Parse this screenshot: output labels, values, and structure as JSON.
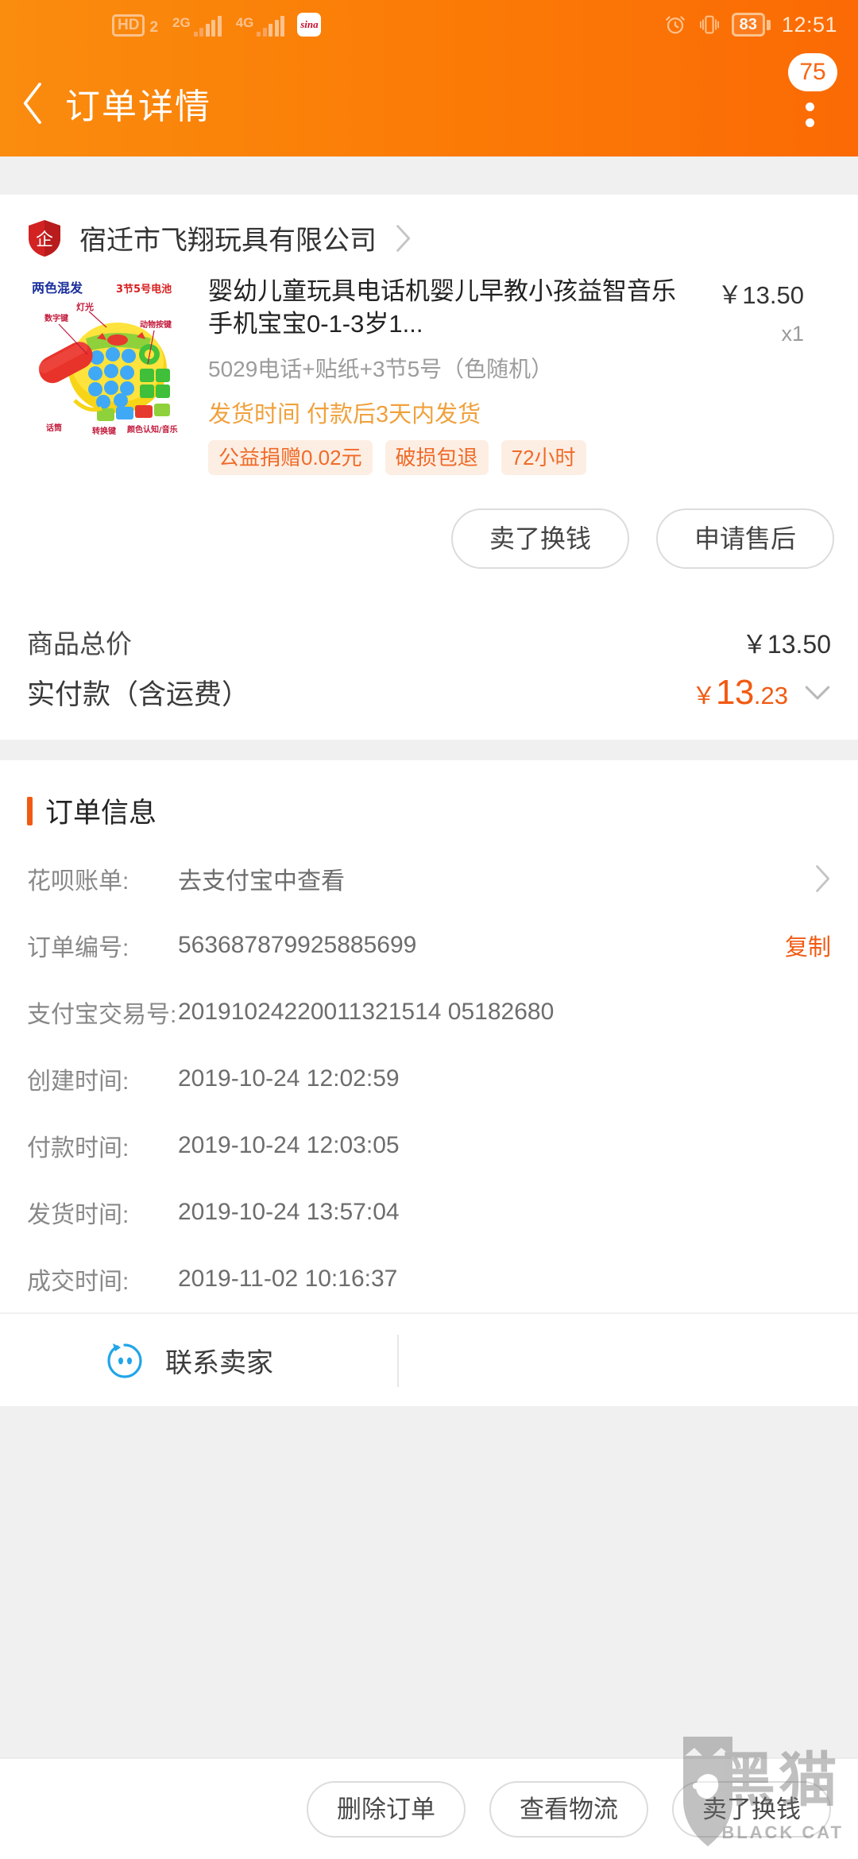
{
  "status_bar": {
    "hd_label": "HD",
    "sim_number": "2",
    "net1_label": "2G",
    "net2_label": "4G",
    "app_icon": "sina-weibo-icon",
    "alarm_icon": "alarm-clock-icon",
    "vibrate_icon": "vibrate-icon",
    "battery_level": "83",
    "time": "12:51"
  },
  "nav": {
    "back_icon": "back-chevron-icon",
    "title": "订单详情",
    "badge_count": "75",
    "menu_icon": "more-vertical-icon"
  },
  "shop": {
    "badge_icon": "enterprise-shield-icon",
    "badge_char": "企",
    "name": "宿迁市飞翔玩具有限公司",
    "arrow_icon": "chevron-right-icon"
  },
  "product": {
    "image_alt": "toy-telephone-thumbnail",
    "image_labels": {
      "top_left": "两色混发",
      "top_right": "3节5号电池",
      "light": "灯光",
      "number_keys": "数字键",
      "animal_keys": "动物按键",
      "handset": "话筒",
      "music_keys": "颜色认知/音乐",
      "switch": "转换键"
    },
    "title": "婴幼儿童玩具电话机婴儿早教小孩益智音乐手机宝宝0-1-3岁1...",
    "price": "￥13.50",
    "quantity": "x1",
    "sku": "5029电话+贴纸+3节5号（色随机）",
    "shipping_note": "发货时间 付款后3天内发货",
    "tags": [
      "公益捐赠0.02元",
      "破损包退",
      "72小时"
    ],
    "actions": [
      "卖了换钱",
      "申请售后"
    ]
  },
  "price_summary": {
    "total_label": "商品总价",
    "total_value": "￥13.50",
    "paid_label": "实付款（含运费）",
    "paid_currency": "￥",
    "paid_int": "13",
    "paid_dec": ".23",
    "expand_icon": "chevron-down-icon"
  },
  "order_info": {
    "section_title": "订单信息",
    "rows": [
      {
        "key": "花呗账单:",
        "value": "去支付宝中查看",
        "action": "",
        "arrow_icon": "chevron-right-icon"
      },
      {
        "key": "订单编号:",
        "value": "563687879925885699",
        "action": "复制",
        "arrow_icon": ""
      },
      {
        "key": "支付宝交易号:",
        "value": "20191024220011321514 05182680",
        "action": "",
        "arrow_icon": ""
      },
      {
        "key": "创建时间:",
        "value": "2019-10-24 12:02:59",
        "action": "",
        "arrow_icon": ""
      },
      {
        "key": "付款时间:",
        "value": "2019-10-24 12:03:05",
        "action": "",
        "arrow_icon": ""
      },
      {
        "key": "发货时间:",
        "value": "2019-10-24 13:57:04",
        "action": "",
        "arrow_icon": ""
      },
      {
        "key": "成交时间:",
        "value": "2019-11-02 10:16:37",
        "action": "",
        "arrow_icon": ""
      }
    ]
  },
  "contact": {
    "icon": "wangwang-icon",
    "label": "联系卖家"
  },
  "bottom_bar": {
    "buttons": [
      "删除订单",
      "查看物流",
      "卖了换钱"
    ]
  },
  "watermark": {
    "icon": "black-cat-shield-icon",
    "cn_text": "黑猫",
    "en_text": "BLACK CAT"
  },
  "colors": {
    "brand_orange": "#fb7a06",
    "accent_orange": "#f15a12",
    "tag_bg": "#fdeee4",
    "tag_text": "#ef6b28",
    "page_bg": "#f0f0f0",
    "link_blue": "#21a5e8"
  }
}
